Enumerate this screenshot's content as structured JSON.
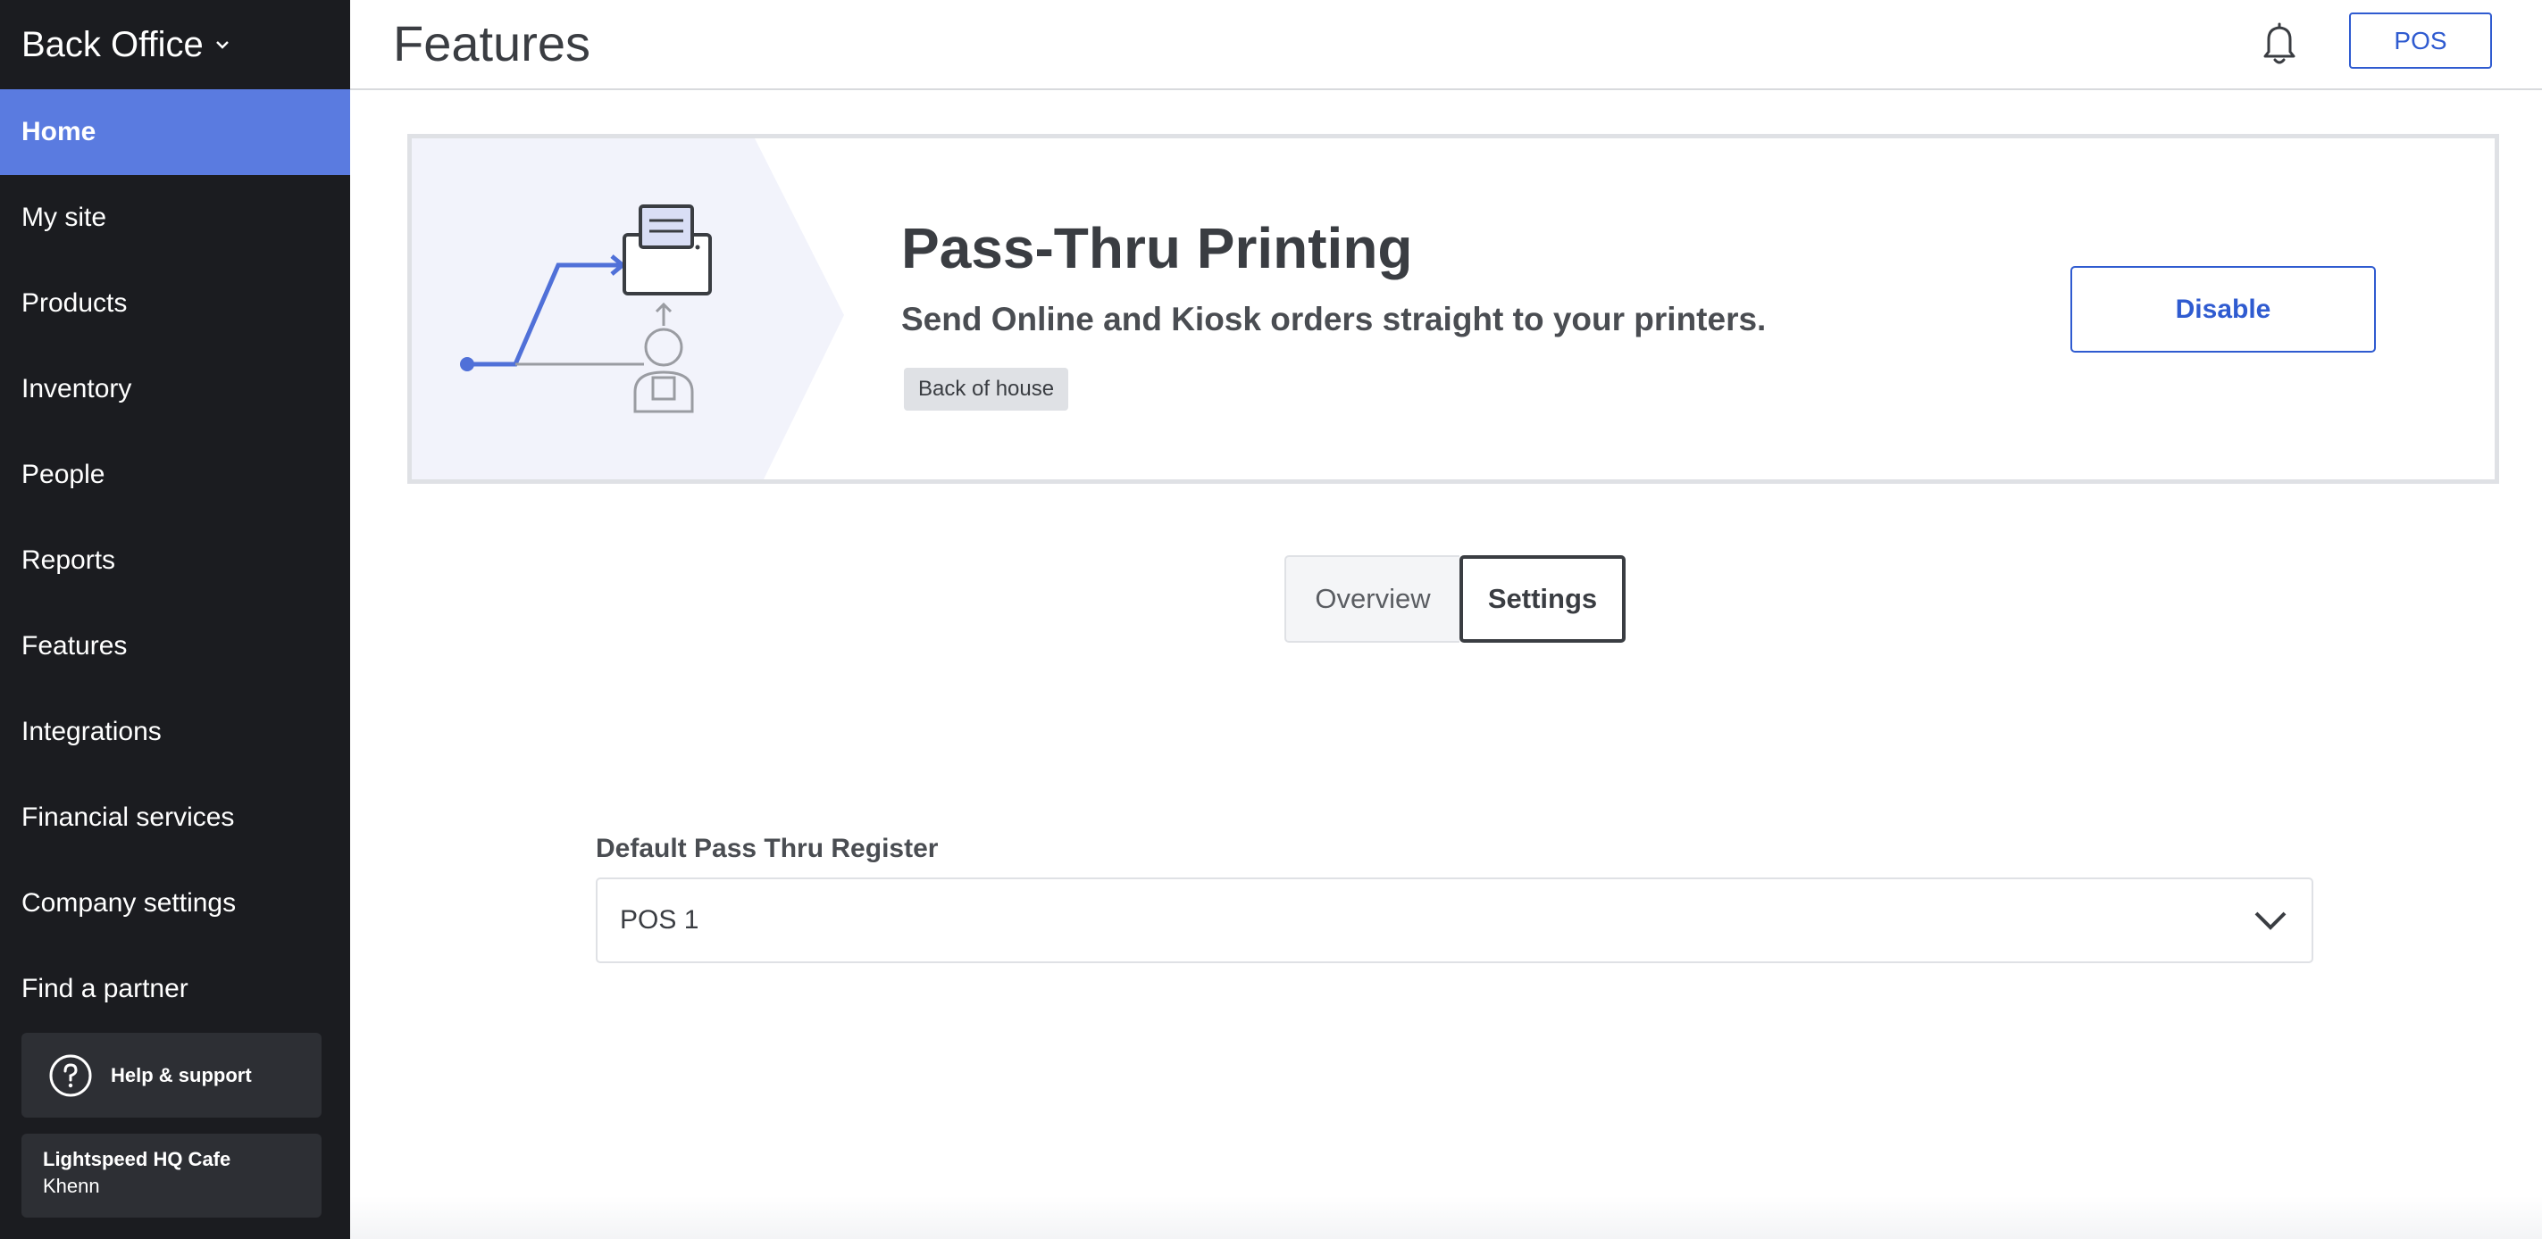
{
  "sidebar": {
    "brand": "Back Office",
    "items": [
      {
        "label": "Home",
        "active": true
      },
      {
        "label": "My site"
      },
      {
        "label": "Products"
      },
      {
        "label": "Inventory"
      },
      {
        "label": "People"
      },
      {
        "label": "Reports"
      },
      {
        "label": "Features"
      },
      {
        "label": "Integrations"
      },
      {
        "label": "Financial services"
      },
      {
        "label": "Company settings"
      },
      {
        "label": "Find a partner"
      }
    ],
    "help_label": "Help & support",
    "account": {
      "location": "Lightspeed HQ Cafe",
      "user": "Khenn"
    }
  },
  "header": {
    "title": "Features",
    "pos_label": "POS",
    "icons": [
      "bell-icon"
    ]
  },
  "feature": {
    "title": "Pass-Thru Printing",
    "subtitle": "Send Online and Kiosk orders straight to your printers.",
    "tag": "Back of house",
    "disable_label": "Disable"
  },
  "tabs": [
    {
      "label": "Overview",
      "selected": false
    },
    {
      "label": "Settings",
      "selected": true
    }
  ],
  "settings": {
    "register_label": "Default Pass Thru Register",
    "register_value": "POS 1"
  },
  "colors": {
    "sidebar_bg": "#1b1c20",
    "active_nav": "#5a7be0",
    "accent": "#2f5bd0"
  }
}
